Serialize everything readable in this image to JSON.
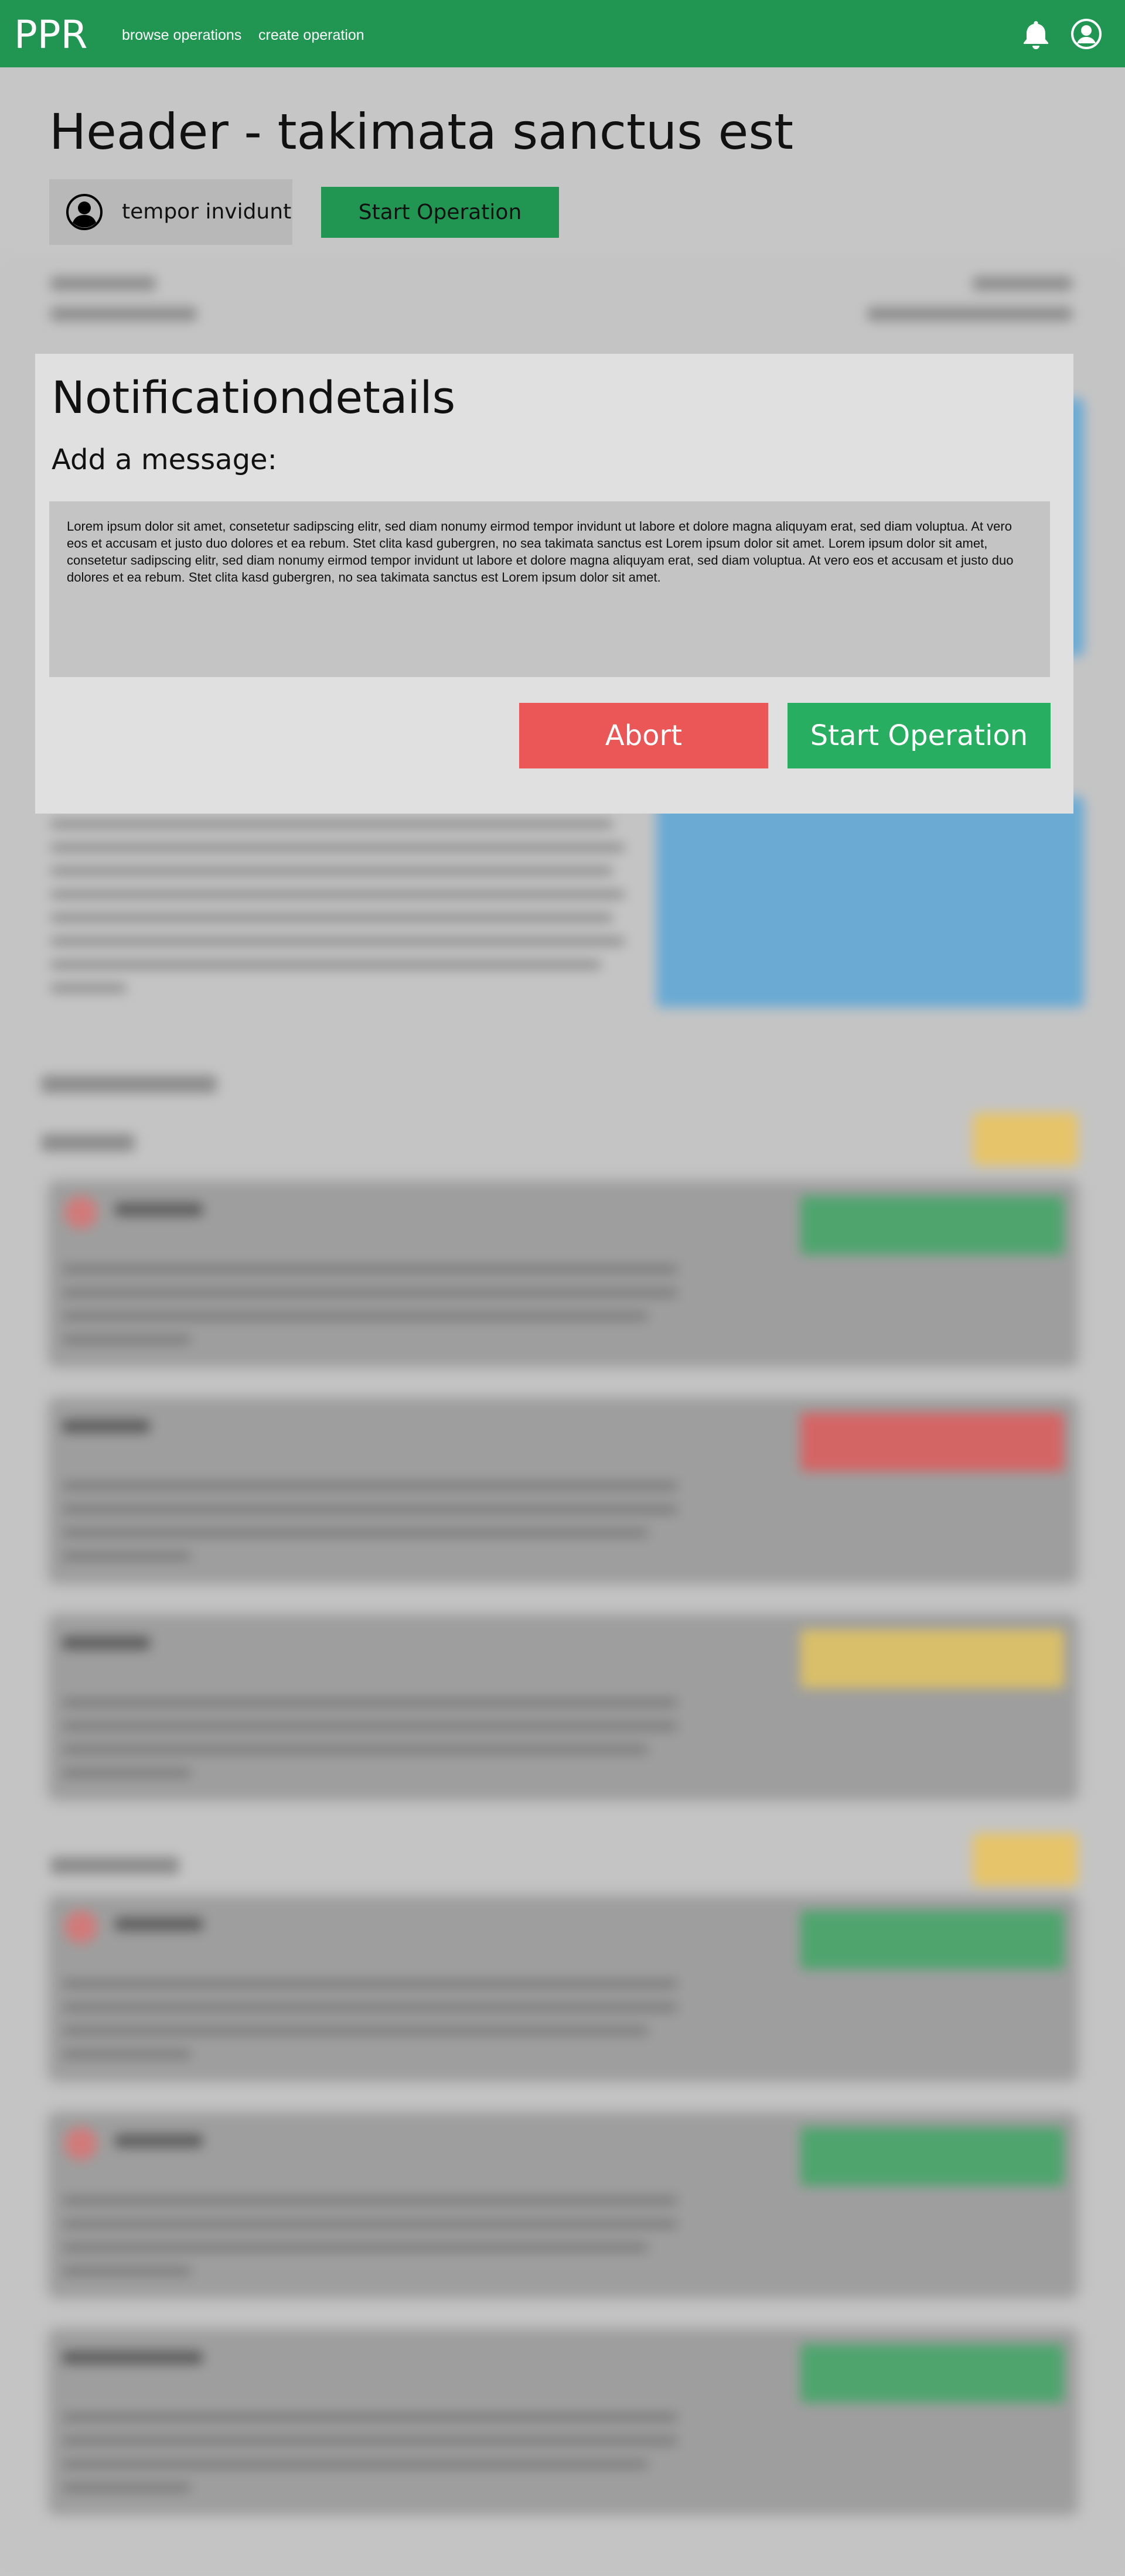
{
  "app": {
    "logo": "PPR",
    "nav": [
      {
        "label": "browse operations"
      },
      {
        "label": "create operation"
      }
    ],
    "icons": {
      "notifications": "bell-icon",
      "profile": "user-circle-icon"
    },
    "brand_color": "#219653"
  },
  "header": {
    "title": "Header - takimata sanctus est",
    "user_name": "tempor invidunt",
    "start_button_label": "Start Operation"
  },
  "modal": {
    "title": "Notificationdetails",
    "subtitle": "Add a message:",
    "message": "Lorem ipsum dolor sit amet, consetetur sadipscing elitr, sed diam nonumy eirmod tempor invidunt ut labore et dolore magna aliquyam erat, sed diam voluptua. At vero eos et accusam et justo duo dolores et ea rebum. Stet clita kasd gubergren, no sea takimata sanctus est Lorem ipsum dolor sit amet. Lorem ipsum dolor sit amet, consetetur sadipscing elitr, sed diam nonumy eirmod tempor invidunt ut labore et dolore magna aliquyam erat, sed diam voluptua. At vero eos et accusam et justo duo dolores et ea rebum. Stet clita kasd gubergren, no sea takimata sanctus est Lorem ipsum dolor sit amet.",
    "abort_label": "Abort",
    "start_label": "Start Operation",
    "abort_color": "#eb5757",
    "start_color": "#27ae60"
  }
}
